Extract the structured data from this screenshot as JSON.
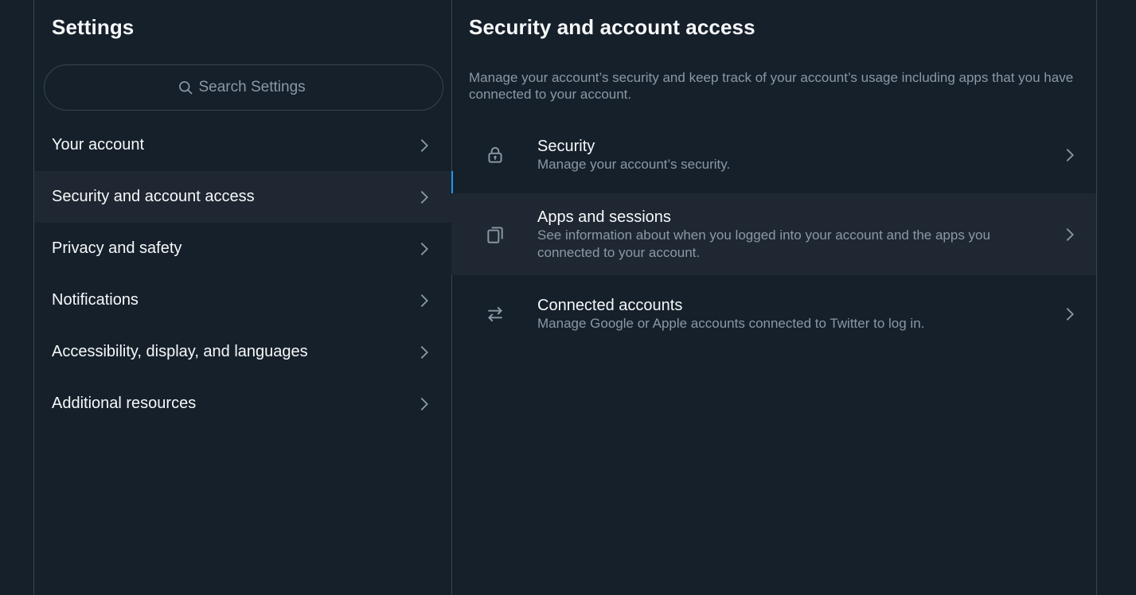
{
  "colors": {
    "background": "#15202b",
    "active_row": "#1e2732",
    "accent": "#1d9bf0",
    "border": "#38444d",
    "secondary_text": "#8b98a5",
    "primary_text": "#f7f9f9"
  },
  "settings": {
    "title": "Settings",
    "search": {
      "placeholder": "Search Settings",
      "icon": "search-icon"
    },
    "items": [
      {
        "label": "Your account"
      },
      {
        "label": "Security and account access",
        "active": true
      },
      {
        "label": "Privacy and safety"
      },
      {
        "label": "Notifications"
      },
      {
        "label": "Accessibility, display, and languages"
      },
      {
        "label": "Additional resources"
      }
    ]
  },
  "detail": {
    "title": "Security and account access",
    "description": "Manage your account’s security and keep track of your account’s usage including apps that you have connected to your account.",
    "items": [
      {
        "title": "Security",
        "subtitle": "Manage your account’s security.",
        "icon": "lock-icon"
      },
      {
        "title": "Apps and sessions",
        "subtitle": "See information about when you logged into your account and the apps you connected to your account.",
        "icon": "copy-icon"
      },
      {
        "title": "Connected accounts",
        "subtitle": "Manage Google or Apple accounts connected to Twitter to log in.",
        "icon": "arrows-swap-icon"
      }
    ]
  }
}
